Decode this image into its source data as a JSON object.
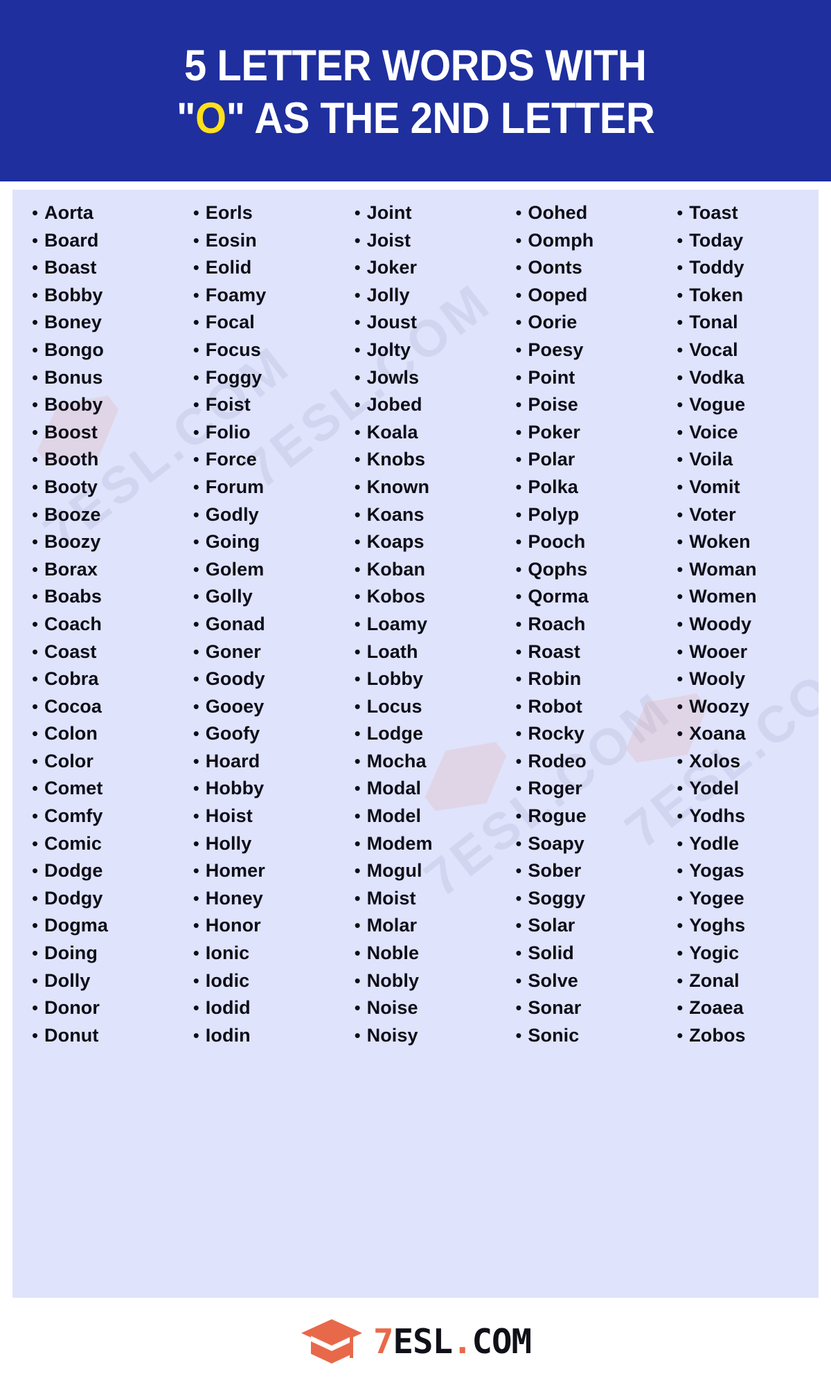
{
  "header": {
    "line1": "5 LETTER WORDS WITH",
    "line2_prefix": "\"",
    "line2_accent": "O",
    "line2_suffix": "\" AS THE 2ND LETTER",
    "line2_full": "\"O\" AS THE 2ND LETTER",
    "background_color": "#1F2F9E",
    "text_color": "#FFFFFF",
    "accent_color": "#FFE01B"
  },
  "panel": {
    "background_color": "#DFE3FB",
    "text_color": "#0D0D17",
    "bullet": "•"
  },
  "watermark": {
    "text": "7ESL.COM",
    "repeat": 4
  },
  "columns": [
    {
      "id": "column-1",
      "words": [
        "Aorta",
        "Board",
        "Boast",
        "Bobby",
        "Boney",
        "Bongo",
        "Bonus",
        "Booby",
        "Boost",
        "Booth",
        "Booty",
        "Booze",
        "Boozy",
        "Borax",
        "Boabs",
        "Coach",
        "Coast",
        "Cobra",
        "Cocoa",
        "Colon",
        "Color",
        "Comet",
        "Comfy",
        "Comic",
        "Dodge",
        "Dodgy",
        "Dogma",
        "Doing",
        "Dolly",
        "Donor",
        "Donut"
      ]
    },
    {
      "id": "column-2",
      "words": [
        "Eorls",
        "Eosin",
        "Eolid",
        "Foamy",
        "Focal",
        "Focus",
        "Foggy",
        "Foist",
        "Folio",
        "Force",
        "Forum",
        "Godly",
        "Going",
        "Golem",
        "Golly",
        "Gonad",
        "Goner",
        "Goody",
        "Gooey",
        "Goofy",
        "Hoard",
        "Hobby",
        "Hoist",
        "Holly",
        "Homer",
        "Honey",
        "Honor",
        "Ionic",
        "Iodic",
        "Iodid",
        "Iodin"
      ]
    },
    {
      "id": "column-3",
      "words": [
        "Joint",
        "Joist",
        "Joker",
        "Jolly",
        "Joust",
        "Jolty",
        "Jowls",
        "Jobed",
        "Koala",
        "Knobs",
        "Known",
        "Koans",
        "Koaps",
        "Koban",
        "Kobos",
        "Loamy",
        "Loath",
        "Lobby",
        "Locus",
        "Lodge",
        "Mocha",
        "Modal",
        "Model",
        "Modem",
        "Mogul",
        "Moist",
        "Molar",
        "Noble",
        "Nobly",
        "Noise",
        "Noisy"
      ]
    },
    {
      "id": "column-4",
      "words": [
        "Oohed",
        "Oomph",
        "Oonts",
        "Ooped",
        "Oorie",
        "Poesy",
        "Point",
        "Poise",
        "Poker",
        "Polar",
        "Polka",
        "Polyp",
        "Pooch",
        "Qophs",
        "Qorma",
        "Roach",
        "Roast",
        "Robin",
        "Robot",
        "Rocky",
        "Rodeo",
        "Roger",
        "Rogue",
        "Soapy",
        "Sober",
        "Soggy",
        "Solar",
        "Solid",
        "Solve",
        "Sonar",
        "Sonic"
      ]
    },
    {
      "id": "column-5",
      "words": [
        "Toast",
        "Today",
        "Toddy",
        "Token",
        "Tonal",
        "Vocal",
        "Vodka",
        "Vogue",
        "Voice",
        "Voila",
        "Vomit",
        "Voter",
        "Woken",
        "Woman",
        "Women",
        "Woody",
        "Wooer",
        "Wooly",
        "Woozy",
        "Xoana",
        "Xolos",
        "Yodel",
        "Yodhs",
        "Yodle",
        "Yogas",
        "Yogee",
        "Yoghs",
        "Yogic",
        "Zonal",
        "Zoaea",
        "Zobos"
      ]
    }
  ],
  "footer": {
    "logo_seven": "7",
    "logo_rest": "ESL",
    "logo_dot": ".",
    "logo_com": "COM",
    "logo_full": "7ESL.COM",
    "mark_color": "#E8694A"
  }
}
